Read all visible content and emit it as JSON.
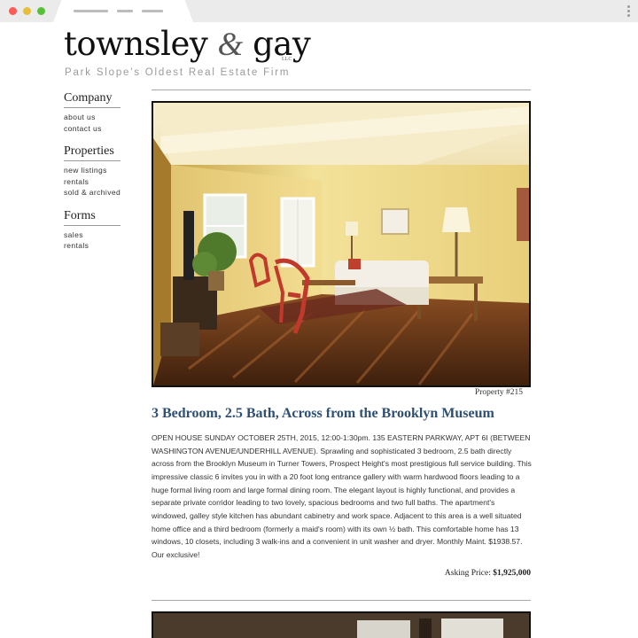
{
  "site": {
    "logo_main": "townsley",
    "logo_amp": "&",
    "logo_end": "gay",
    "llc": "LLC",
    "tagline": "Park Slope's Oldest Real Estate Firm"
  },
  "sidebar": {
    "groups": [
      {
        "heading": "Company",
        "links": [
          "about us",
          "contact us"
        ]
      },
      {
        "heading": "Properties",
        "links": [
          "new listings",
          "rentals",
          "sold & archived"
        ]
      },
      {
        "heading": "Forms",
        "links": [
          "sales",
          "rentals"
        ]
      }
    ]
  },
  "listing": {
    "property_number": "Property #215",
    "title": "3 Bedroom, 2.5 Bath, Across from the Brooklyn Museum",
    "description": "OPEN HOUSE SUNDAY OCTOBER 25TH, 2015, 12:00-1:30pm.  135 EASTERN PARKWAY, APT 6I (BETWEEN WASHINGTON AVENUE/UNDERHILL AVENUE).  Sprawling and sophisticated 3 bedroom, 2.5 bath directly across from the Brooklyn Museum in Turner Towers, Prospect Height's most prestigious full service building. This impressive classic 6 invites you in with a 20 foot long entrance gallery with warm hardwood floors leading to a huge formal living room and large formal dining room. The elegant layout is highly functional, and provides a separate private corridor leading to two lovely, spacious bedrooms and two full baths. The apartment's windowed, galley style kitchen has abundant cabinetry and work space. Adjacent to this area is a well situated home office and a third bedroom (formerly a maid's room) with its own ½ bath. This comfortable home has 13 windows, 10 closets, including 3 walk-ins and a convenient in unit washer and dryer. Monthly Maint. $1938.57. Our exclusive!",
    "price_label": "Asking Price:",
    "price_value": "$1,925,000"
  },
  "colors": {
    "title": "#2f4f73",
    "wall": "#f0dc8a",
    "floor": "#6b3a1c"
  }
}
